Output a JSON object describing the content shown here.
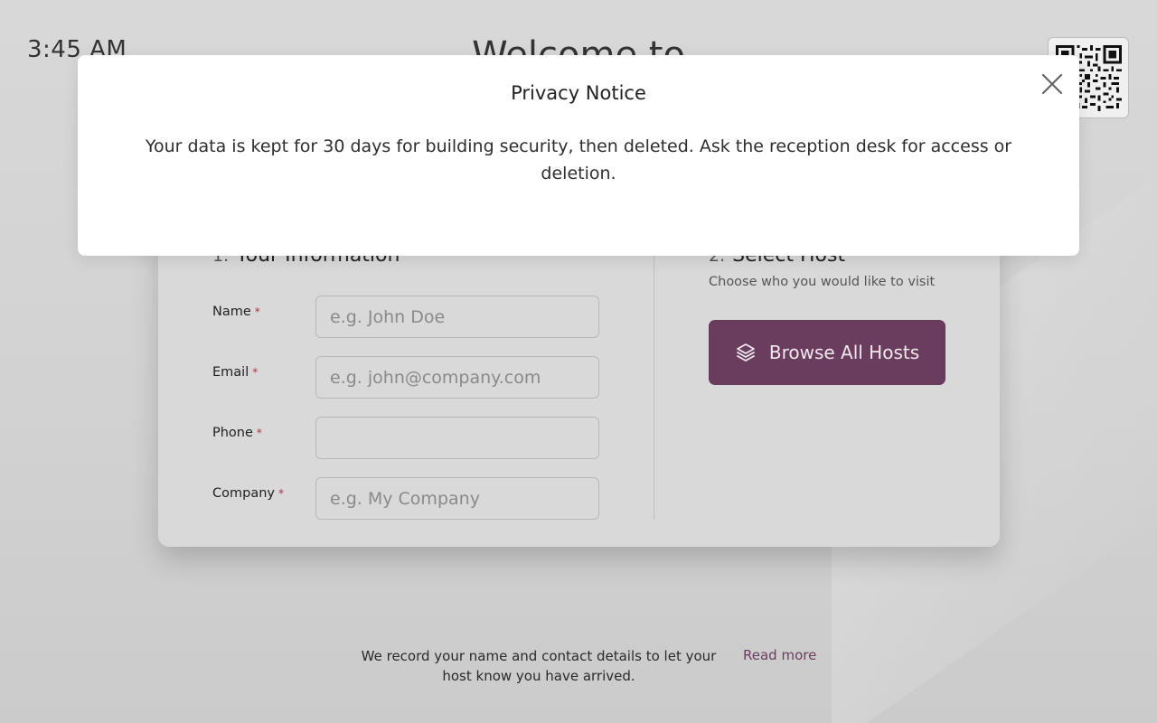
{
  "header": {
    "clock": "3:45 AM",
    "welcome_title": "Welcome to"
  },
  "qr": {
    "icon": "qr-code-icon"
  },
  "form": {
    "section1": {
      "number": "1.",
      "title": "Your Information"
    },
    "section2": {
      "number": "2.",
      "title": "Select Host",
      "subtitle": "Choose who you would like to visit"
    },
    "required_marker": "*",
    "fields": [
      {
        "label": "Name",
        "placeholder": "e.g. John Doe",
        "value": ""
      },
      {
        "label": "Email",
        "placeholder": "e.g. john@company.com",
        "value": ""
      },
      {
        "label": "Phone",
        "placeholder": "",
        "value": ""
      },
      {
        "label": "Company",
        "placeholder": "e.g. My Company",
        "value": ""
      }
    ],
    "browse_button": {
      "label": "Browse All Hosts",
      "icon": "layers-icon"
    }
  },
  "footer": {
    "note": "We record your name and contact details to let your host know you have arrived.",
    "read_more": "Read more"
  },
  "modal": {
    "title": "Privacy Notice",
    "body": "Your data is kept for 30 days for building security, then deleted. Ask the reception desk for access or deletion.",
    "close_icon": "close-icon"
  },
  "colors": {
    "accent": "#6a3d5e",
    "required": "#b0303b",
    "background": "#d4d4d4",
    "card": "#d9d9d9",
    "modal": "#ffffff"
  }
}
